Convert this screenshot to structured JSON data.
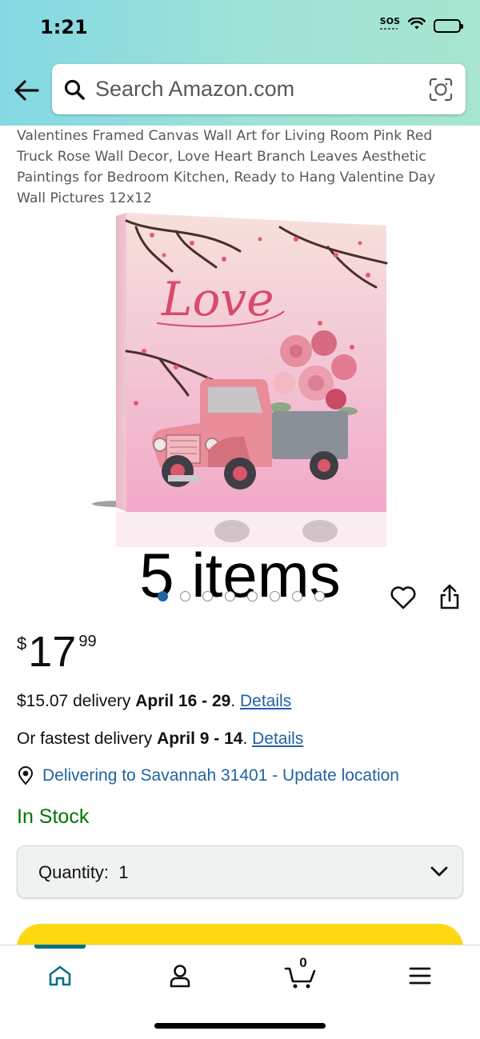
{
  "status_bar": {
    "time": "1:21",
    "sos": "SOS"
  },
  "search": {
    "placeholder": "Search Amazon.com"
  },
  "product": {
    "title": "Valentines Framed Canvas Wall Art for Living Room Pink Red Truck Rose Wall Decor, Love Heart Branch Leaves Aesthetic Paintings for Bedroom Kitchen, Ready to Hang Valentine Day Wall Pictures 12x12",
    "image_text": "Love",
    "image_overlay_label": "5 items",
    "carousel": {
      "total": 8,
      "active_index": 0
    }
  },
  "price": {
    "currency": "$",
    "whole": "17",
    "fraction": "99"
  },
  "delivery": {
    "standard_prefix": "$15.07 delivery ",
    "standard_dates": "April 16 - 29",
    "standard_sep": ". ",
    "details_label": "Details",
    "fastest_prefix": "Or fastest delivery ",
    "fastest_dates": "April 9 - 14",
    "fastest_sep": ". ",
    "fastest_details_label": "Details",
    "location": "Delivering to Savannah 31401 - Update location"
  },
  "stock": {
    "status": "In Stock",
    "color": "#007600"
  },
  "quantity": {
    "label": "Quantity:",
    "value": "1"
  },
  "bottom_nav": {
    "items": [
      {
        "name": "home",
        "icon": "home-icon",
        "active": true
      },
      {
        "name": "account",
        "icon": "person-icon",
        "active": false
      },
      {
        "name": "cart",
        "icon": "cart-icon",
        "count": "0",
        "active": false
      },
      {
        "name": "menu",
        "icon": "menu-icon",
        "active": false
      }
    ]
  },
  "colors": {
    "link": "#2162a1",
    "accent": "#007185",
    "add_to_cart": "#ffd814",
    "header_gradient_start": "#84d8e4",
    "header_gradient_end": "#a7e5cf"
  }
}
